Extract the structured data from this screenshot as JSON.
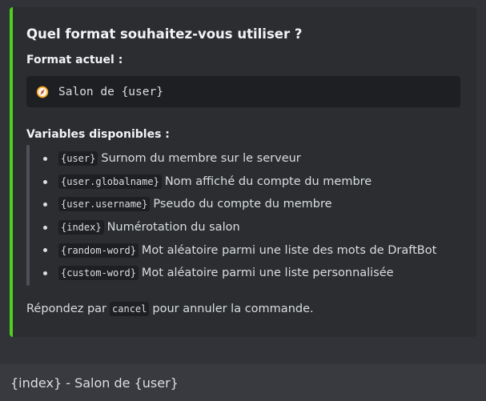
{
  "embed": {
    "accent_color": "#4cd11f",
    "title": "Quel format souhaitez-vous utiliser ?",
    "current_format_label": "Format actuel :",
    "current_format_icon": "compass-icon",
    "current_format_value": "Salon de {user}",
    "variables_label": "Variables disponibles :",
    "variables": [
      {
        "code": "{user}",
        "description": "Surnom du membre sur le serveur"
      },
      {
        "code": "{user.globalname}",
        "description": "Nom affiché du compte du membre"
      },
      {
        "code": "{user.username}",
        "description": "Pseudo du compte du membre"
      },
      {
        "code": "{index}",
        "description": "Numérotation du salon"
      },
      {
        "code": "{random-word}",
        "description": "Mot aléatoire parmi une liste des mots de DraftBot"
      },
      {
        "code": "{custom-word}",
        "description": "Mot aléatoire parmi une liste personnalisée"
      }
    ],
    "footer": {
      "prefix": "Répondez par",
      "code": "cancel",
      "suffix": "pour annuler la commande."
    }
  },
  "message_input": {
    "value": "{index} - Salon de {user}"
  }
}
